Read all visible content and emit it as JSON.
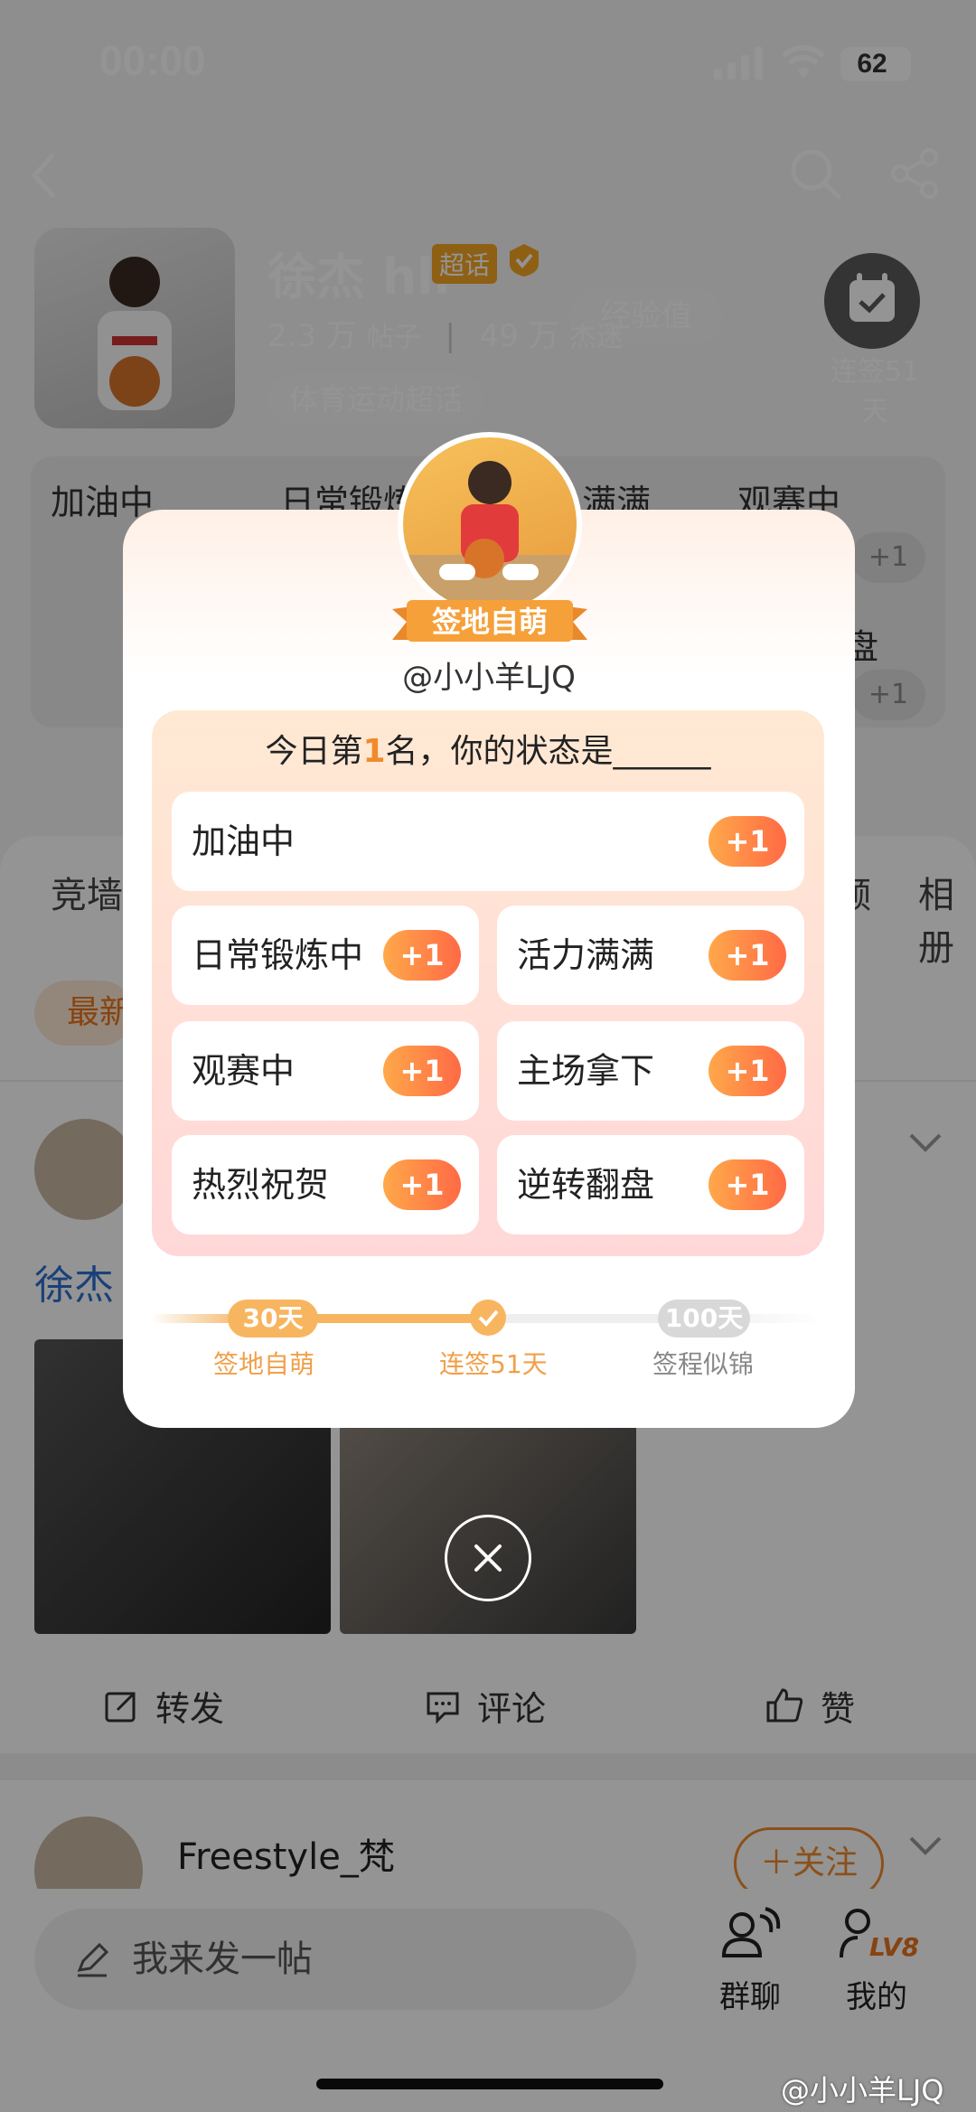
{
  "status_bar": {
    "time": "00:00",
    "battery": "62"
  },
  "header": {
    "title": "徐杰 hll",
    "super_badge": "超话",
    "posts_count": "2.3 万",
    "posts_label": "帖子",
    "fans_count": "49 万",
    "fans_label": "杰迷",
    "category": "体育运动超话",
    "exp_label": "经验值",
    "checkin_status": "连签51天"
  },
  "status_cards_bg": {
    "items": [
      "加油中",
      "日常锻炼",
      "满满",
      "观赛中",
      "盘"
    ],
    "plus": "+1"
  },
  "feed": {
    "tabs": [
      "竞墙",
      "频",
      "相册"
    ],
    "sort_label": "最新",
    "post1_name_fragment": "徐杰",
    "actions": {
      "forward": "转发",
      "comment": "评论",
      "like": "赞"
    },
    "post2_name": "Freestyle_梵",
    "follow_label": "＋关注"
  },
  "bottom_nav": {
    "compose_placeholder": "我来发一帖",
    "group_chat": "群聊",
    "mine": "我的",
    "level_badge": "LV8"
  },
  "modal": {
    "level_title": "签地自萌",
    "username": "@小小羊LJQ",
    "question_prefix": "今日第",
    "rank": "1",
    "question_suffix": "名，你的状态是______",
    "options": [
      {
        "label": "加油中",
        "plus": "+1"
      },
      {
        "label": "日常锻炼中",
        "plus": "+1"
      },
      {
        "label": "活力满满",
        "plus": "+1"
      },
      {
        "label": "观赛中",
        "plus": "+1"
      },
      {
        "label": "主场拿下",
        "plus": "+1"
      },
      {
        "label": "热烈祝贺",
        "plus": "+1"
      },
      {
        "label": "逆转翻盘",
        "plus": "+1"
      }
    ],
    "milestones": {
      "first_days": "30天",
      "first_label": "签地自萌",
      "current_label": "连签51天",
      "next_days": "100天",
      "next_label": "签程似锦"
    }
  },
  "watermark": "@小小羊LJQ",
  "colors": {
    "accent": "#f08a2c",
    "plus_start": "#ffa84a",
    "plus_end": "#ff6a45",
    "milestone": "#f8b560"
  }
}
